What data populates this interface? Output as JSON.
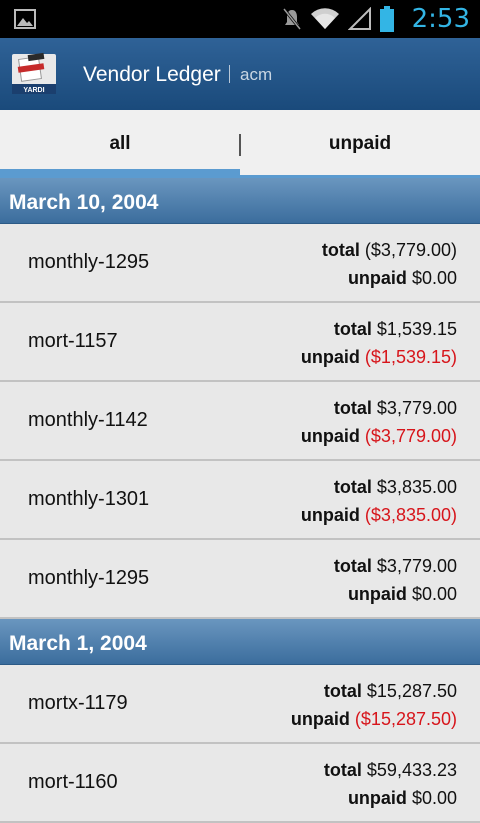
{
  "status_bar": {
    "time": "2:53",
    "icons": [
      "gallery-icon",
      "mute-icon",
      "wifi-icon",
      "signal-icon",
      "battery-icon"
    ],
    "accent_color": "#33b5e5"
  },
  "action_bar": {
    "title": "Vendor Ledger",
    "subtitle": "acm",
    "logo_text": "YARDI",
    "background": "#1f4f82"
  },
  "tabs": [
    {
      "label": "all",
      "selected": true
    },
    {
      "label": "unpaid",
      "selected": false
    }
  ],
  "labels": {
    "total": "total",
    "unpaid": "unpaid"
  },
  "sections": [
    {
      "date": "March 10, 2004",
      "items": [
        {
          "name": "monthly-1295",
          "total": "($3,779.00)",
          "unpaid": "$0.00",
          "unpaid_negative": false
        },
        {
          "name": "mort-1157",
          "total": "$1,539.15",
          "unpaid": "($1,539.15)",
          "unpaid_negative": true
        },
        {
          "name": "monthly-1142",
          "total": "$3,779.00",
          "unpaid": "($3,779.00)",
          "unpaid_negative": true
        },
        {
          "name": "monthly-1301",
          "total": "$3,835.00",
          "unpaid": "($3,835.00)",
          "unpaid_negative": true
        },
        {
          "name": "monthly-1295",
          "total": "$3,779.00",
          "unpaid": "$0.00",
          "unpaid_negative": false
        }
      ]
    },
    {
      "date": "March 1, 2004",
      "items": [
        {
          "name": "mortx-1179",
          "total": "$15,287.50",
          "unpaid": "($15,287.50)",
          "unpaid_negative": true
        },
        {
          "name": "mort-1160",
          "total": "$59,433.23",
          "unpaid": "$0.00",
          "unpaid_negative": false
        }
      ]
    }
  ],
  "colors": {
    "negative": "#d7151b",
    "tab_indicator": "#5b9bd0",
    "section_header": "#4a7aa8"
  }
}
